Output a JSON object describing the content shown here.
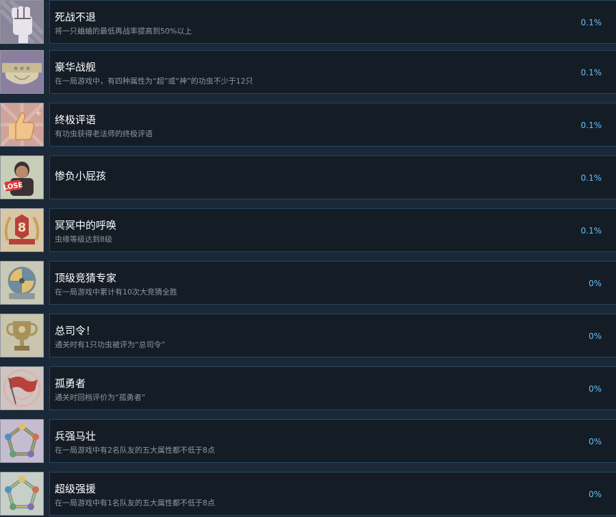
{
  "achievements": [
    {
      "title": "死战不退",
      "description": "将一只蛐蛐的最低再战率提高到50%以上",
      "percent": "0.1%",
      "icon": "raised-fist-icon",
      "icon_bg": "#8a8598"
    },
    {
      "title": "豪华战舰",
      "description": "在一局游戏中，有四种属性为“超”或“神”的功虫不少于12只",
      "percent": "0.1%",
      "icon": "star-shield-icon",
      "icon_bg": "#8b7fa0"
    },
    {
      "title": "终极评语",
      "description": "有功虫获得老法师的终极评语",
      "percent": "0.1%",
      "icon": "thumbs-up-icon",
      "icon_bg": "#cfa29a"
    },
    {
      "title": "惨负小屁孩",
      "description": "",
      "percent": "0.1%",
      "icon": "lose-kid-icon",
      "icon_bg": "#c7cdb8"
    },
    {
      "title": "冥冥中的呼唤",
      "description": "虫缘等级达到8级",
      "percent": "0.1%",
      "icon": "level-8-badge-icon",
      "icon_bg": "#d8c7a4"
    },
    {
      "title": "顶级竞猜专家",
      "description": "在一局游戏中累计有10次大竞猜全胜",
      "percent": "0%",
      "icon": "wheel-emblem-icon",
      "icon_bg": "#c9c9b8"
    },
    {
      "title": "总司令！",
      "description": "通关时有1只功虫被评为“总司令”",
      "percent": "0%",
      "icon": "trophy-icon",
      "icon_bg": "#c8c4ae"
    },
    {
      "title": "孤勇者",
      "description": "通关时回档评价为“孤勇者”",
      "percent": "0%",
      "icon": "flag-icon",
      "icon_bg": "#cfc4c0"
    },
    {
      "title": "兵强马壮",
      "description": "在一局游戏中有2名队友的五大属性都不低于8点",
      "percent": "0%",
      "icon": "pentagon-stats-icon",
      "icon_bg": "#c6bcd0"
    },
    {
      "title": "超级强援",
      "description": "在一局游戏中有1名队友的五大属性都不低于8点",
      "percent": "0%",
      "icon": "pentagon-support-icon",
      "icon_bg": "#c7cfc6"
    }
  ]
}
